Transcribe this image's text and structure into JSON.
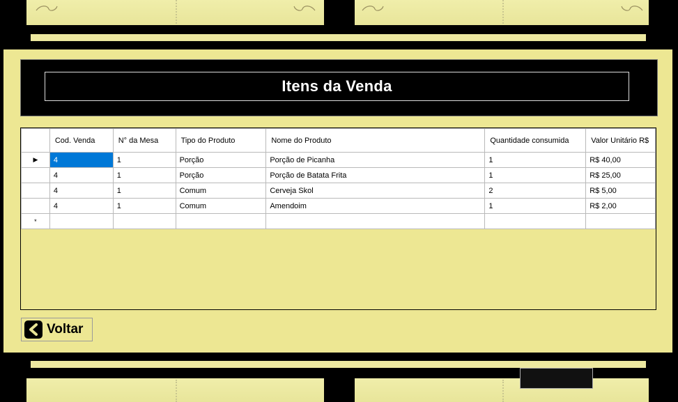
{
  "dialog": {
    "title": "Itens da Venda",
    "back_label": "Voltar"
  },
  "grid": {
    "columns": [
      "Cod. Venda",
      "N° da Mesa",
      "Tipo do Produto",
      "Nome do Produto",
      "Quantidade consumida",
      "Valor Unitário R$"
    ],
    "rows": [
      [
        "4",
        "1",
        "Porção",
        "Porção de Picanha",
        "1",
        "R$ 40,00"
      ],
      [
        "4",
        "1",
        "Porção",
        "Porção de Batata Frita",
        "1",
        "R$ 25,00"
      ],
      [
        "4",
        "1",
        "Comum",
        "Cerveja Skol",
        "2",
        "R$ 5,00"
      ],
      [
        "4",
        "1",
        "Comum",
        "Amendoim",
        "1",
        "R$ 2,00"
      ]
    ],
    "current_row_marker": "▶",
    "new_row_marker": "*"
  },
  "icons": {
    "back": "chevron-left-icon"
  },
  "colors": {
    "panel": "#ede793",
    "header": "#000000",
    "selection": "#0078d7"
  }
}
